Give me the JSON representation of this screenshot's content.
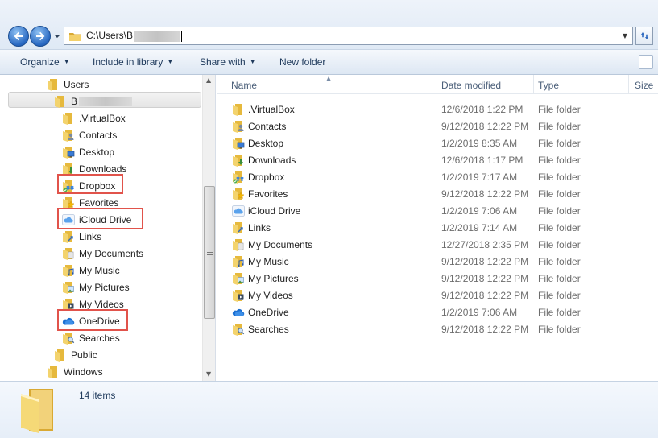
{
  "address": {
    "path_prefix": "C:\\Users\\B",
    "path_redacted": true
  },
  "toolbar": {
    "organize": "Organize",
    "include_in_library": "Include in library",
    "share_with": "Share with",
    "new_folder": "New folder"
  },
  "nav_tree": {
    "users": "Users",
    "user_initial": "B",
    "items": [
      {
        "label": ".VirtualBox",
        "icon": "folder-icon"
      },
      {
        "label": "Contacts",
        "icon": "contacts-folder-icon"
      },
      {
        "label": "Desktop",
        "icon": "desktop-folder-icon"
      },
      {
        "label": "Downloads",
        "icon": "downloads-folder-icon"
      },
      {
        "label": "Dropbox",
        "icon": "dropbox-icon"
      },
      {
        "label": "Favorites",
        "icon": "favorites-folder-icon"
      },
      {
        "label": "iCloud Drive",
        "icon": "icloud-icon"
      },
      {
        "label": "Links",
        "icon": "links-folder-icon"
      },
      {
        "label": "My Documents",
        "icon": "documents-folder-icon"
      },
      {
        "label": "My Music",
        "icon": "music-folder-icon"
      },
      {
        "label": "My Pictures",
        "icon": "pictures-folder-icon"
      },
      {
        "label": "My Videos",
        "icon": "videos-folder-icon"
      },
      {
        "label": "OneDrive",
        "icon": "onedrive-icon"
      },
      {
        "label": "Searches",
        "icon": "searches-folder-icon"
      }
    ],
    "public": "Public",
    "windows": "Windows"
  },
  "columns": {
    "name": "Name",
    "date_modified": "Date modified",
    "type": "Type",
    "size": "Size"
  },
  "files": [
    {
      "name": ".VirtualBox",
      "date": "12/6/2018 1:22 PM",
      "type": "File folder"
    },
    {
      "name": "Contacts",
      "date": "9/12/2018 12:22 PM",
      "type": "File folder"
    },
    {
      "name": "Desktop",
      "date": "1/2/2019 8:35 AM",
      "type": "File folder"
    },
    {
      "name": "Downloads",
      "date": "12/6/2018 1:17 PM",
      "type": "File folder"
    },
    {
      "name": "Dropbox",
      "date": "1/2/2019 7:17 AM",
      "type": "File folder"
    },
    {
      "name": "Favorites",
      "date": "9/12/2018 12:22 PM",
      "type": "File folder"
    },
    {
      "name": "iCloud Drive",
      "date": "1/2/2019 7:06 AM",
      "type": "File folder"
    },
    {
      "name": "Links",
      "date": "1/2/2019 7:14 AM",
      "type": "File folder"
    },
    {
      "name": "My Documents",
      "date": "12/27/2018 2:35 PM",
      "type": "File folder"
    },
    {
      "name": "My Music",
      "date": "9/12/2018 12:22 PM",
      "type": "File folder"
    },
    {
      "name": "My Pictures",
      "date": "9/12/2018 12:22 PM",
      "type": "File folder"
    },
    {
      "name": "My Videos",
      "date": "9/12/2018 12:22 PM",
      "type": "File folder"
    },
    {
      "name": "OneDrive",
      "date": "1/2/2019 7:06 AM",
      "type": "File folder"
    },
    {
      "name": "Searches",
      "date": "9/12/2018 12:22 PM",
      "type": "File folder"
    }
  ],
  "status": {
    "item_count": "14 items"
  },
  "colors": {
    "folder": "#e8c25a",
    "highlight": "#e1534b",
    "accent": "#2868c2"
  }
}
